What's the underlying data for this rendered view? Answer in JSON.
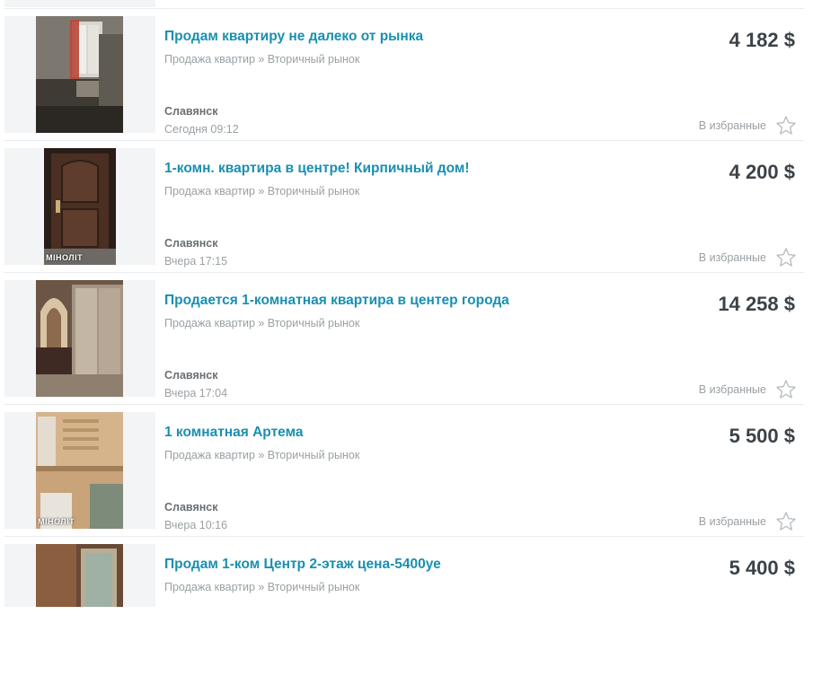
{
  "listings": [
    {
      "title": "Продам квартиру не далеко от рынка",
      "category": "Продажа квартир » Вторичный рынок",
      "city": "Славянск",
      "time": "Сегодня 09:12",
      "price": "4 182 $",
      "favorite_label": "В избранные",
      "icon": "star-outline-icon"
    },
    {
      "title": "1-комн. квартира в центре! Кирпичный дом!",
      "category": "Продажа квартир » Вторичный рынок",
      "city": "Славянск",
      "time": "Вчера 17:15",
      "price": "4 200 $",
      "favorite_label": "В избранные",
      "watermark": "MIНОЛІТ",
      "icon": "star-outline-icon"
    },
    {
      "title": "Продается 1-комнатная квартира в центер города",
      "category": "Продажа квартир » Вторичный рынок",
      "city": "Славянск",
      "time": "Вчера 17:04",
      "price": "14 258 $",
      "favorite_label": "В избранные",
      "icon": "star-outline-icon"
    },
    {
      "title": "1 комнатная Артема",
      "category": "Продажа квартир » Вторичный рынок",
      "city": "Славянск",
      "time": "Вчера 10:16",
      "price": "5 500 $",
      "favorite_label": "В избранные",
      "watermark": "MIНОЛІТ",
      "icon": "star-outline-icon"
    },
    {
      "title": "Продам 1-ком Центр 2-этаж цена-5400уе",
      "category": "Продажа квартир » Вторичный рынок",
      "price": "5 400 $"
    }
  ],
  "colors": {
    "title_link": "#1a8fb0",
    "price": "#3b4248",
    "muted_text": "#9aa0a4",
    "thumb_bg": "#f2f4f5",
    "star": "#b8bec2"
  }
}
